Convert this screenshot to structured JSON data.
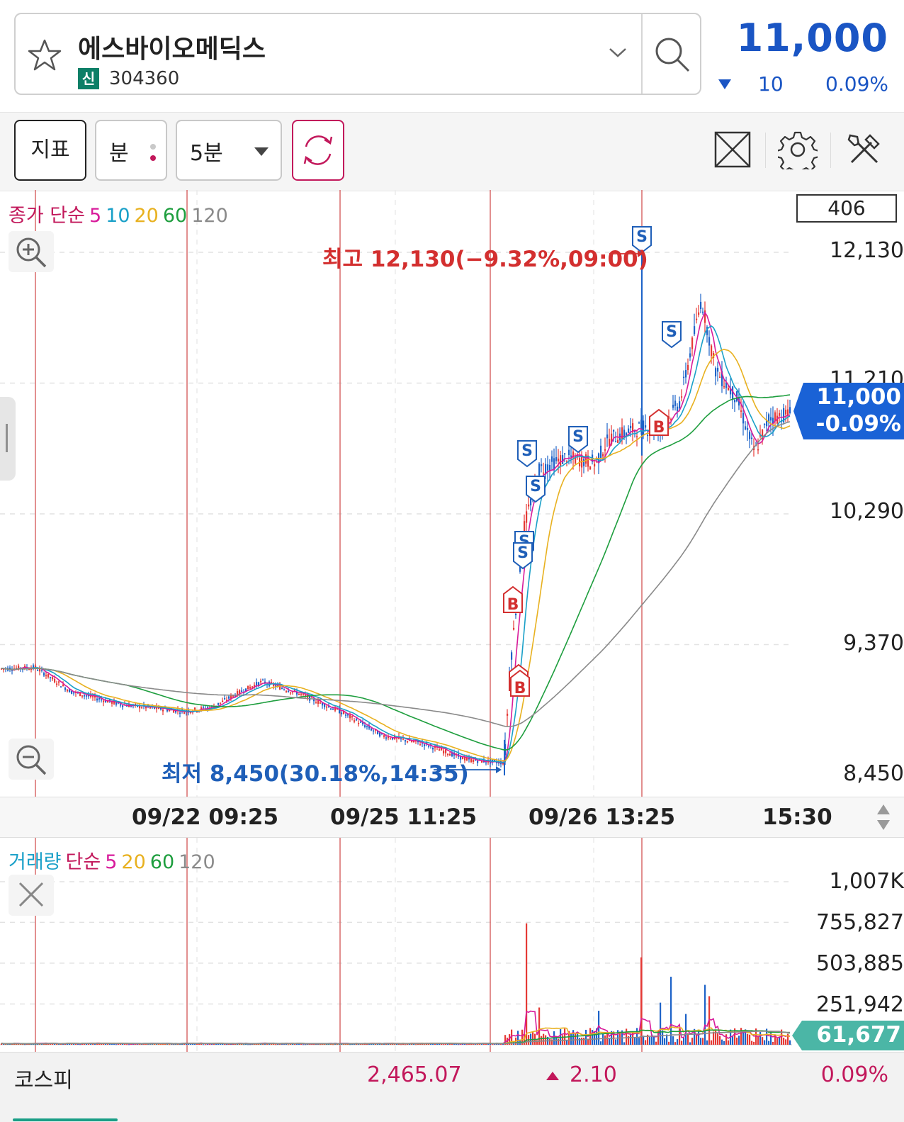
{
  "header": {
    "stock_name": "에스바이오메딕스",
    "market_badge": "신",
    "stock_code": "304360",
    "price": "11,000",
    "change_direction": "down",
    "change_abs": "10",
    "change_pct": "0.09%"
  },
  "toolbar": {
    "indicator_label": "지표",
    "minute_label": "분",
    "period_label": "5분"
  },
  "chart": {
    "ma_legend": [
      {
        "text": "종가 단순",
        "color": "#c2185b"
      },
      {
        "text": "5",
        "color": "#d81b9b"
      },
      {
        "text": "10",
        "color": "#1aa0c8"
      },
      {
        "text": "20",
        "color": "#e8b120"
      },
      {
        "text": "60",
        "color": "#1e9e3e"
      },
      {
        "text": "120",
        "color": "#8a8a8a"
      }
    ],
    "visible_count": "406",
    "price_axis": [
      "12,130",
      "11,210",
      "10,290",
      "9,370",
      "8,450"
    ],
    "current_price": "11,000",
    "current_change": "-0.09%",
    "high_annotation": "최고 12,130(−9.32%,09:00)",
    "low_annotation": "최저 8,450(30.18%,14:35)",
    "time_labels": [
      "09/22 09:25",
      "09/25 11:25",
      "09/26 13:25",
      "15:30"
    ]
  },
  "volume": {
    "legend": [
      {
        "text": "거래량",
        "color": "#1aa0c8"
      },
      {
        "text": "단순",
        "color": "#c2185b"
      },
      {
        "text": "5",
        "color": "#d81b9b"
      },
      {
        "text": "20",
        "color": "#e8b120"
      },
      {
        "text": "60",
        "color": "#1e9e3e"
      },
      {
        "text": "120",
        "color": "#8a8a8a"
      }
    ],
    "axis": [
      "1,007K",
      "755,827",
      "503,885",
      "251,942"
    ],
    "current_volume": "61,677"
  },
  "index_bar": {
    "name": "코스피",
    "value": "2,465.07",
    "change_direction": "up",
    "change": "2.10",
    "change_pct": "0.09%"
  },
  "chart_data": {
    "type": "line",
    "title": "",
    "ylim": [
      8450,
      12130
    ],
    "series": [
      {
        "name": "종가",
        "x": [
          "09/22 09:25",
          "09/25 11:25",
          "09/26 13:25",
          "15:30"
        ],
        "values": [
          9200,
          8700,
          11200,
          11000
        ]
      }
    ],
    "markers": [
      {
        "type": "high",
        "value": 12130,
        "time": "09:00"
      },
      {
        "type": "low",
        "value": 8450,
        "time": "14:35"
      }
    ]
  }
}
